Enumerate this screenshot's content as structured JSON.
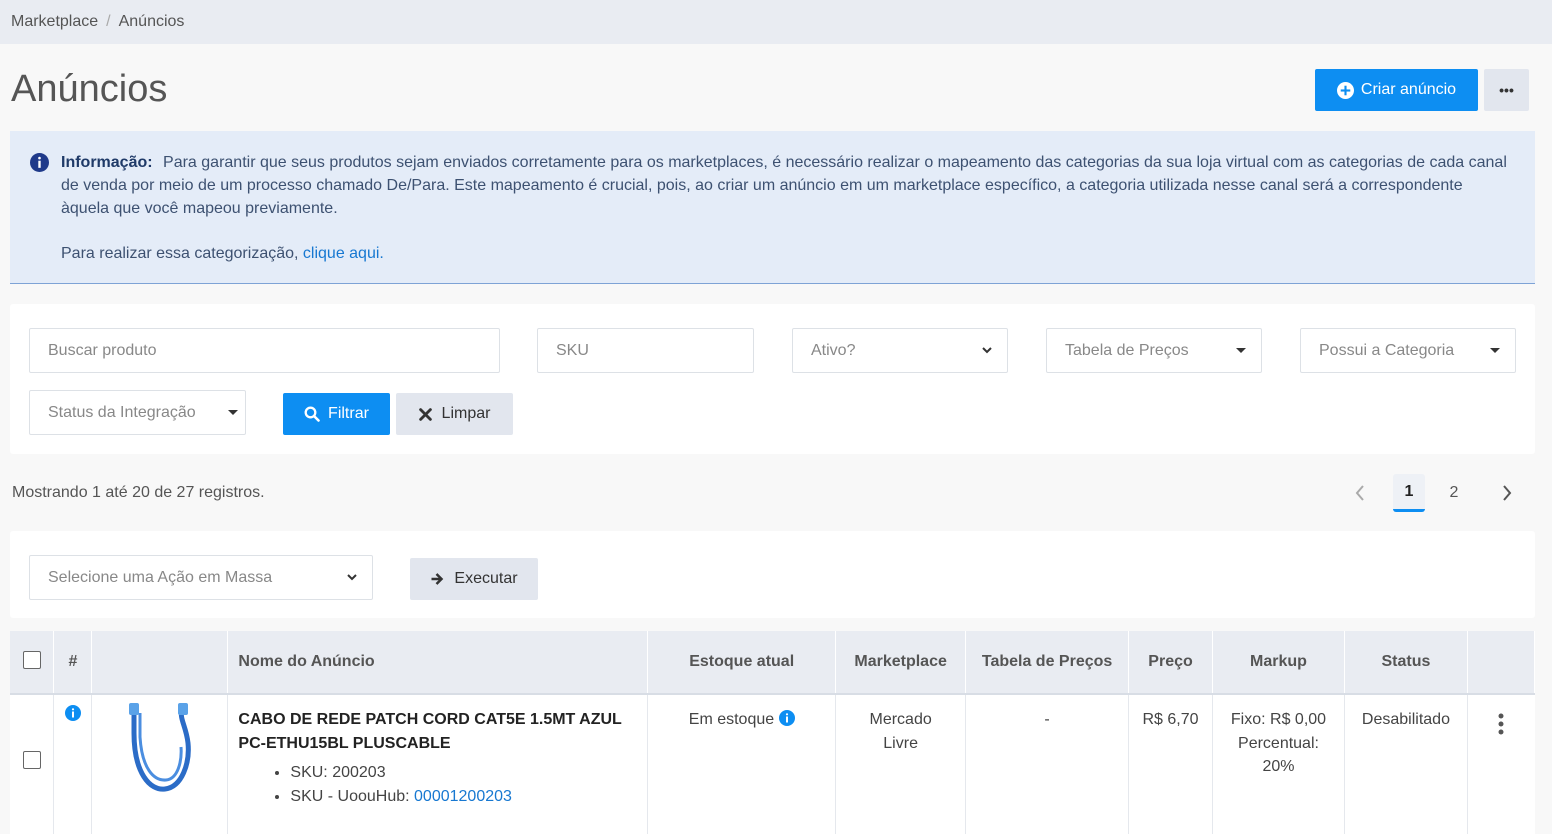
{
  "breadcrumb": {
    "items": [
      "Marketplace",
      "Anúncios"
    ]
  },
  "page": {
    "title": "Anúncios"
  },
  "actions": {
    "create_label": "Criar anúncio",
    "more_label": "•••"
  },
  "info": {
    "title": "Informação:",
    "text": "Para garantir que seus produtos sejam enviados corretamente para os marketplaces, é necessário realizar o mapeamento das categorias da sua loja virtual com as categorias de cada canal de venda por meio de um processo chamado De/Para. Este mapeamento é crucial, pois, ao criar um anúncio em um marketplace específico, a categoria utilizada nesse canal será a correspondente àquela que você mapeou previamente.",
    "text2": "Para realizar essa categorização,",
    "link": "clique aqui."
  },
  "filters": {
    "search_placeholder": "Buscar produto",
    "sku_placeholder": "SKU",
    "active_select": "Ativo?",
    "price_table": "Tabela de Preços",
    "has_category": "Possui a Categoria",
    "integration_status": "Status da Integração",
    "filter_label": "Filtrar",
    "clear_label": "Limpar"
  },
  "records_text": "Mostrando 1 até 20 de 27 registros.",
  "pagination": {
    "pages": [
      "1",
      "2"
    ],
    "current": "1"
  },
  "mass_action": {
    "placeholder": "Selecione uma Ação em Massa",
    "execute_label": "Executar"
  },
  "table": {
    "headers": [
      "#",
      "Nome do Anúncio",
      "Estoque atual",
      "Marketplace",
      "Tabela de Preços",
      "Preço",
      "Markup",
      "Status"
    ],
    "rows": [
      {
        "name": "CABO DE REDE PATCH CORD CAT5E 1.5MT AZUL PC-ETHU15BL PLUSCABLE",
        "sku": "SKU: 200203",
        "sku_hub_label": "SKU - UoouHub:",
        "sku_hub": "00001200203",
        "stock": "Em estoque",
        "marketplace": "Mercado Livre",
        "price_table": "-",
        "price": "R$ 6,70",
        "markup_fixed": "Fixo: R$ 0,00",
        "markup_pct_label": "Percentual:",
        "markup_pct": "20%",
        "status": "Desabilitado"
      }
    ]
  },
  "colors": {
    "primary": "#0d8ef2",
    "info_bg": "#e4ecf8",
    "link": "#1778d1"
  }
}
